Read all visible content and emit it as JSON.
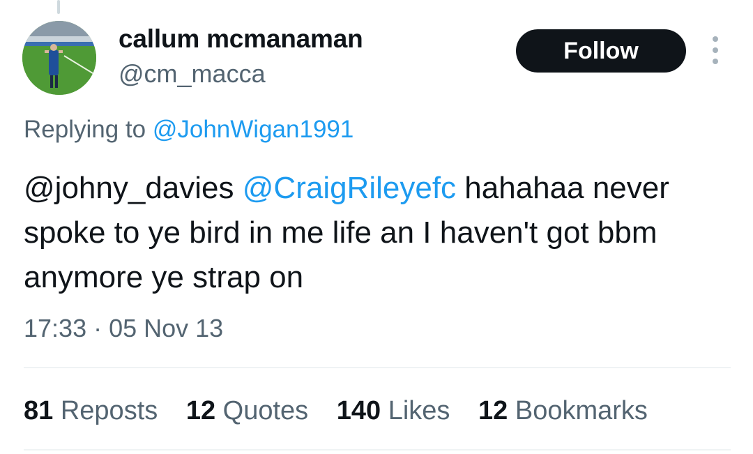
{
  "tweet": {
    "author": {
      "display_name": "callum mcmanaman",
      "handle": "@cm_macca",
      "avatar_icon": "footballer-photo-avatar"
    },
    "follow_label": "Follow",
    "more_icon": "vertical-ellipsis-icon",
    "replying_prefix": "Replying to",
    "replying_to": "@JohnWigan1991",
    "text": {
      "mention_1": "@johny_davies",
      "mention_2": "@CraigRileyefc",
      "body": "hahahaa never spoke to ye bird in me life an I haven't got bbm anymore ye strap on"
    },
    "timestamp": "17:33 · 05 Nov 13"
  },
  "stats": {
    "reposts": {
      "count": "81",
      "label": "Reposts"
    },
    "quotes": {
      "count": "12",
      "label": "Quotes"
    },
    "likes": {
      "count": "140",
      "label": "Likes"
    },
    "bookmarks": {
      "count": "12",
      "label": "Bookmarks"
    }
  },
  "colors": {
    "link": "#1d9bf0",
    "secondary_text": "#536471",
    "primary_text": "#0f1419",
    "follow_bg": "#0f1419"
  }
}
